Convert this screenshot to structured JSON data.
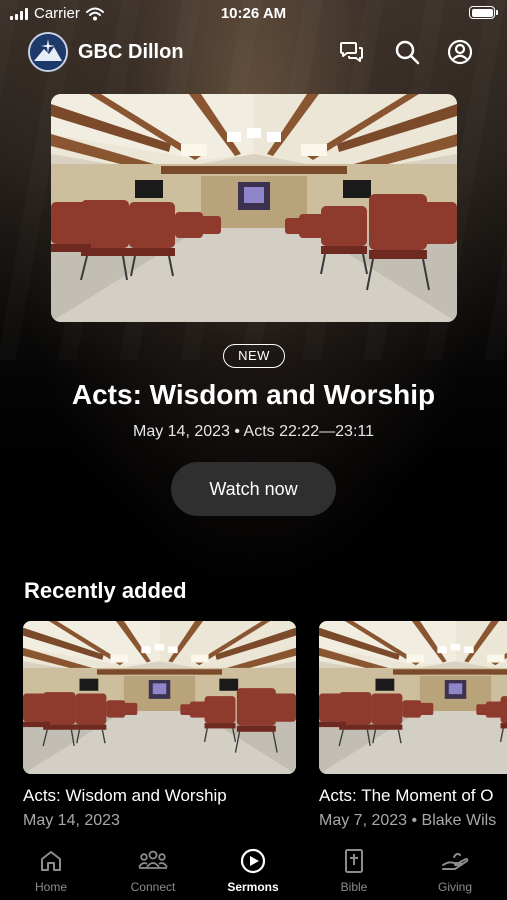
{
  "status_bar": {
    "carrier": "Carrier",
    "time": "10:26 AM",
    "signal_icon": "signal-bars-icon",
    "wifi_icon": "wifi-icon",
    "battery_icon": "battery-icon",
    "battery_level": 1.0
  },
  "header": {
    "title": "GBC Dillon",
    "logo_icon": "church-logo-icon",
    "icons": [
      "chat-icon",
      "search-icon",
      "profile-icon"
    ]
  },
  "hero": {
    "badge": "NEW",
    "title": "Acts: Wisdom and Worship",
    "meta": "May 14, 2023 • Acts 22:22—23:11",
    "button_label": "Watch now"
  },
  "recently_added": {
    "title": "Recently added",
    "items": [
      {
        "title": "Acts: Wisdom and Worship",
        "meta": "May 14, 2023"
      },
      {
        "title": "Acts: The Moment of O",
        "meta": "May 7, 2023 • Blake Wils"
      }
    ]
  },
  "tabs": [
    {
      "label": "Home",
      "icon": "home-icon",
      "active": false
    },
    {
      "label": "Connect",
      "icon": "group-icon",
      "active": false
    },
    {
      "label": "Sermons",
      "icon": "play-circle-icon",
      "active": true
    },
    {
      "label": "Bible",
      "icon": "bible-icon",
      "active": false
    },
    {
      "label": "Giving",
      "icon": "giving-hand-icon",
      "active": false
    }
  ],
  "colors": {
    "background": "#000000",
    "button_bg": "#2f2f2f",
    "muted_text": "#a8a8a8",
    "tab_inactive": "#8c8c8c",
    "tab_active": "#ffffff"
  }
}
